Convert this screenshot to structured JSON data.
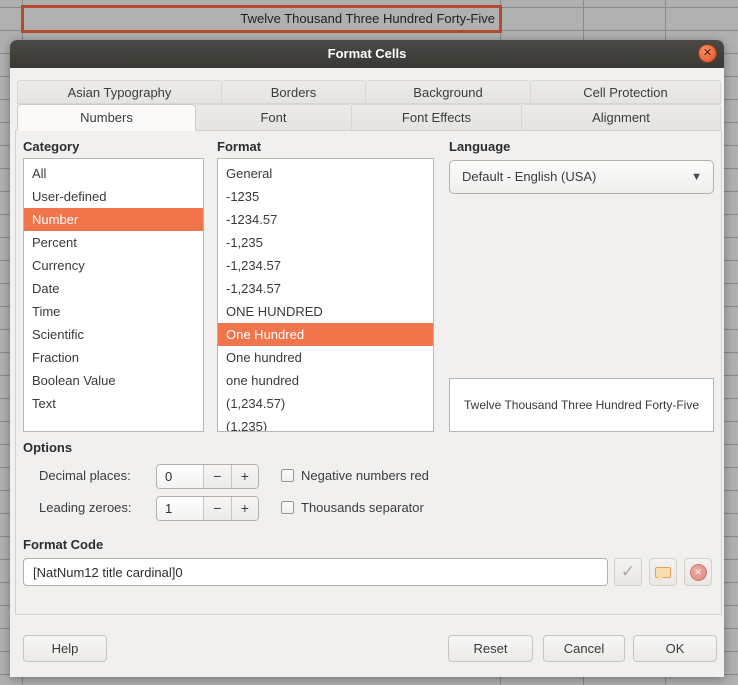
{
  "spreadsheet": {
    "active_cell_text": "Twelve Thousand Three Hundred Forty-Five"
  },
  "dialog": {
    "title": "Format Cells",
    "tabs_row1": [
      "Asian Typography",
      "Borders",
      "Background",
      "Cell Protection"
    ],
    "tabs_row2": [
      "Numbers",
      "Font",
      "Font Effects",
      "Alignment"
    ],
    "active_tab": "Numbers",
    "category": {
      "label": "Category",
      "selected": "Number",
      "items": [
        "All",
        "User-defined",
        "Number",
        "Percent",
        "Currency",
        "Date",
        "Time",
        "Scientific",
        "Fraction",
        "Boolean Value",
        "Text"
      ]
    },
    "format": {
      "label": "Format",
      "selected": "One Hundred",
      "items": [
        "General",
        "-1235",
        "-1234.57",
        "-1,235",
        "-1,234.57",
        "-1,234.57",
        "ONE HUNDRED",
        "One Hundred",
        "One hundred",
        "one hundred",
        "(1,234.57)",
        "(1,235)"
      ]
    },
    "language": {
      "label": "Language",
      "value": "Default - English (USA)"
    },
    "preview_text": "Twelve Thousand Three Hundred Forty-Five",
    "options": {
      "label": "Options",
      "decimal_places": {
        "label": "Decimal places:",
        "value": "0"
      },
      "leading_zeroes": {
        "label": "Leading zeroes:",
        "value": "1"
      },
      "negative_numbers_red": {
        "label": "Negative numbers red",
        "checked": false
      },
      "thousands_separator": {
        "label": "Thousands separator",
        "checked": false
      }
    },
    "format_code": {
      "label": "Format Code",
      "value": "[NatNum12 title cardinal]0"
    },
    "buttons": {
      "help": "Help",
      "reset": "Reset",
      "cancel": "Cancel",
      "ok": "OK"
    },
    "icons": {
      "close": "✕",
      "dropdown": "▼",
      "check": "✓",
      "delete": "✕",
      "minus": "−",
      "plus": "+"
    },
    "colors": {
      "accent": "#f0744c",
      "titlebar": "#3a3934",
      "close_button": "#ea6138",
      "cell_border": "#b44a30"
    }
  }
}
